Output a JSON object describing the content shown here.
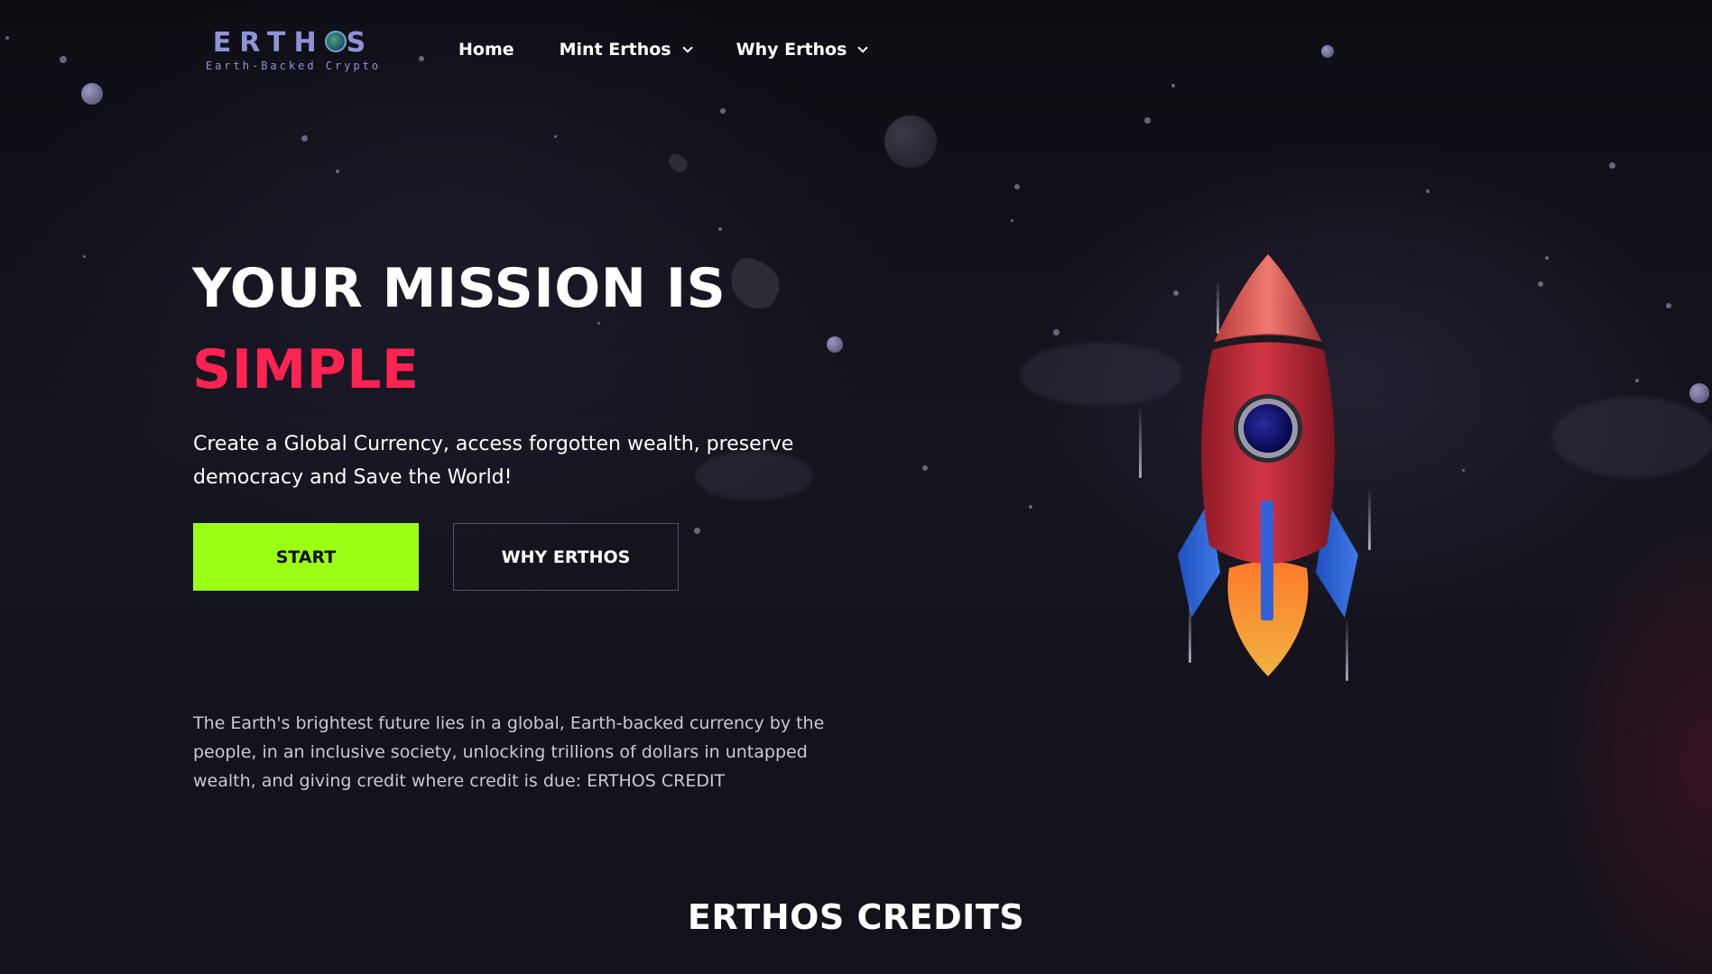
{
  "logo": {
    "word_before": "ERTH",
    "word_after": "S",
    "tagline": "Earth-Backed Crypto",
    "icon": "globe-icon"
  },
  "nav": {
    "items": [
      {
        "label": "Home",
        "has_dropdown": false
      },
      {
        "label": "Mint Erthos",
        "has_dropdown": true
      },
      {
        "label": "Why Erthos",
        "has_dropdown": true
      }
    ]
  },
  "hero": {
    "title_line1": "YOUR MISSION IS",
    "title_line2": "SIMPLE",
    "subtitle": "Create a Global Currency, access forgotten wealth, preserve democracy and Save the World!",
    "start_label": "START",
    "why_label": "WHY ERTHOS",
    "description": "The Earth's brightest future lies in a global, Earth-backed currency by the people, in an inclusive society, unlocking trillions of dollars in untapped wealth, and giving credit where credit is due: ERTHOS CREDIT",
    "illustration": "rocket-illustration"
  },
  "credits": {
    "title": "ERTHOS CREDITS"
  },
  "colors": {
    "background": "#111018",
    "accent_green": "#9bff16",
    "accent_red": "#ff2352",
    "logo_blue": "#8f93d6"
  }
}
